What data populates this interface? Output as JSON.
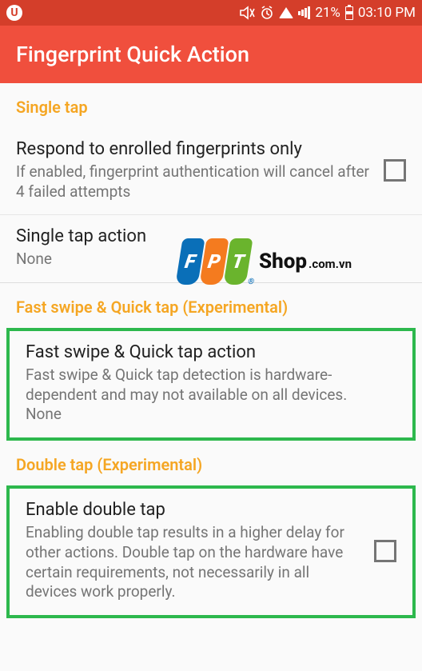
{
  "status": {
    "battery_pct": "21%",
    "clock": "03:10 PM"
  },
  "app": {
    "title": "Fingerprint Quick Action"
  },
  "sections": {
    "single_tap": {
      "header": "Single tap",
      "item_respond": {
        "title": "Respond to enrolled fingerprints only",
        "desc": "If enabled, fingerprint authentication will cancel after 4 failed attempts"
      },
      "item_action": {
        "title": "Single tap action",
        "value": "None"
      }
    },
    "fast_swipe": {
      "header": "Fast swipe & Quick tap (Experimental)",
      "item": {
        "title": "Fast swipe & Quick tap action",
        "desc": "Fast swipe & Quick tap detection is hardware-dependent and may not available on all devices.",
        "value": "None"
      }
    },
    "double_tap": {
      "header": "Double tap (Experimental)",
      "item_enable": {
        "title": "Enable double tap",
        "desc": "Enabling double tap results in a higher delay for other actions. Double tap on the hardware have certain requirements, not necessarily in all devices work properly."
      }
    }
  },
  "watermark": {
    "shop": "Shop",
    "domain": ".com.vn"
  }
}
